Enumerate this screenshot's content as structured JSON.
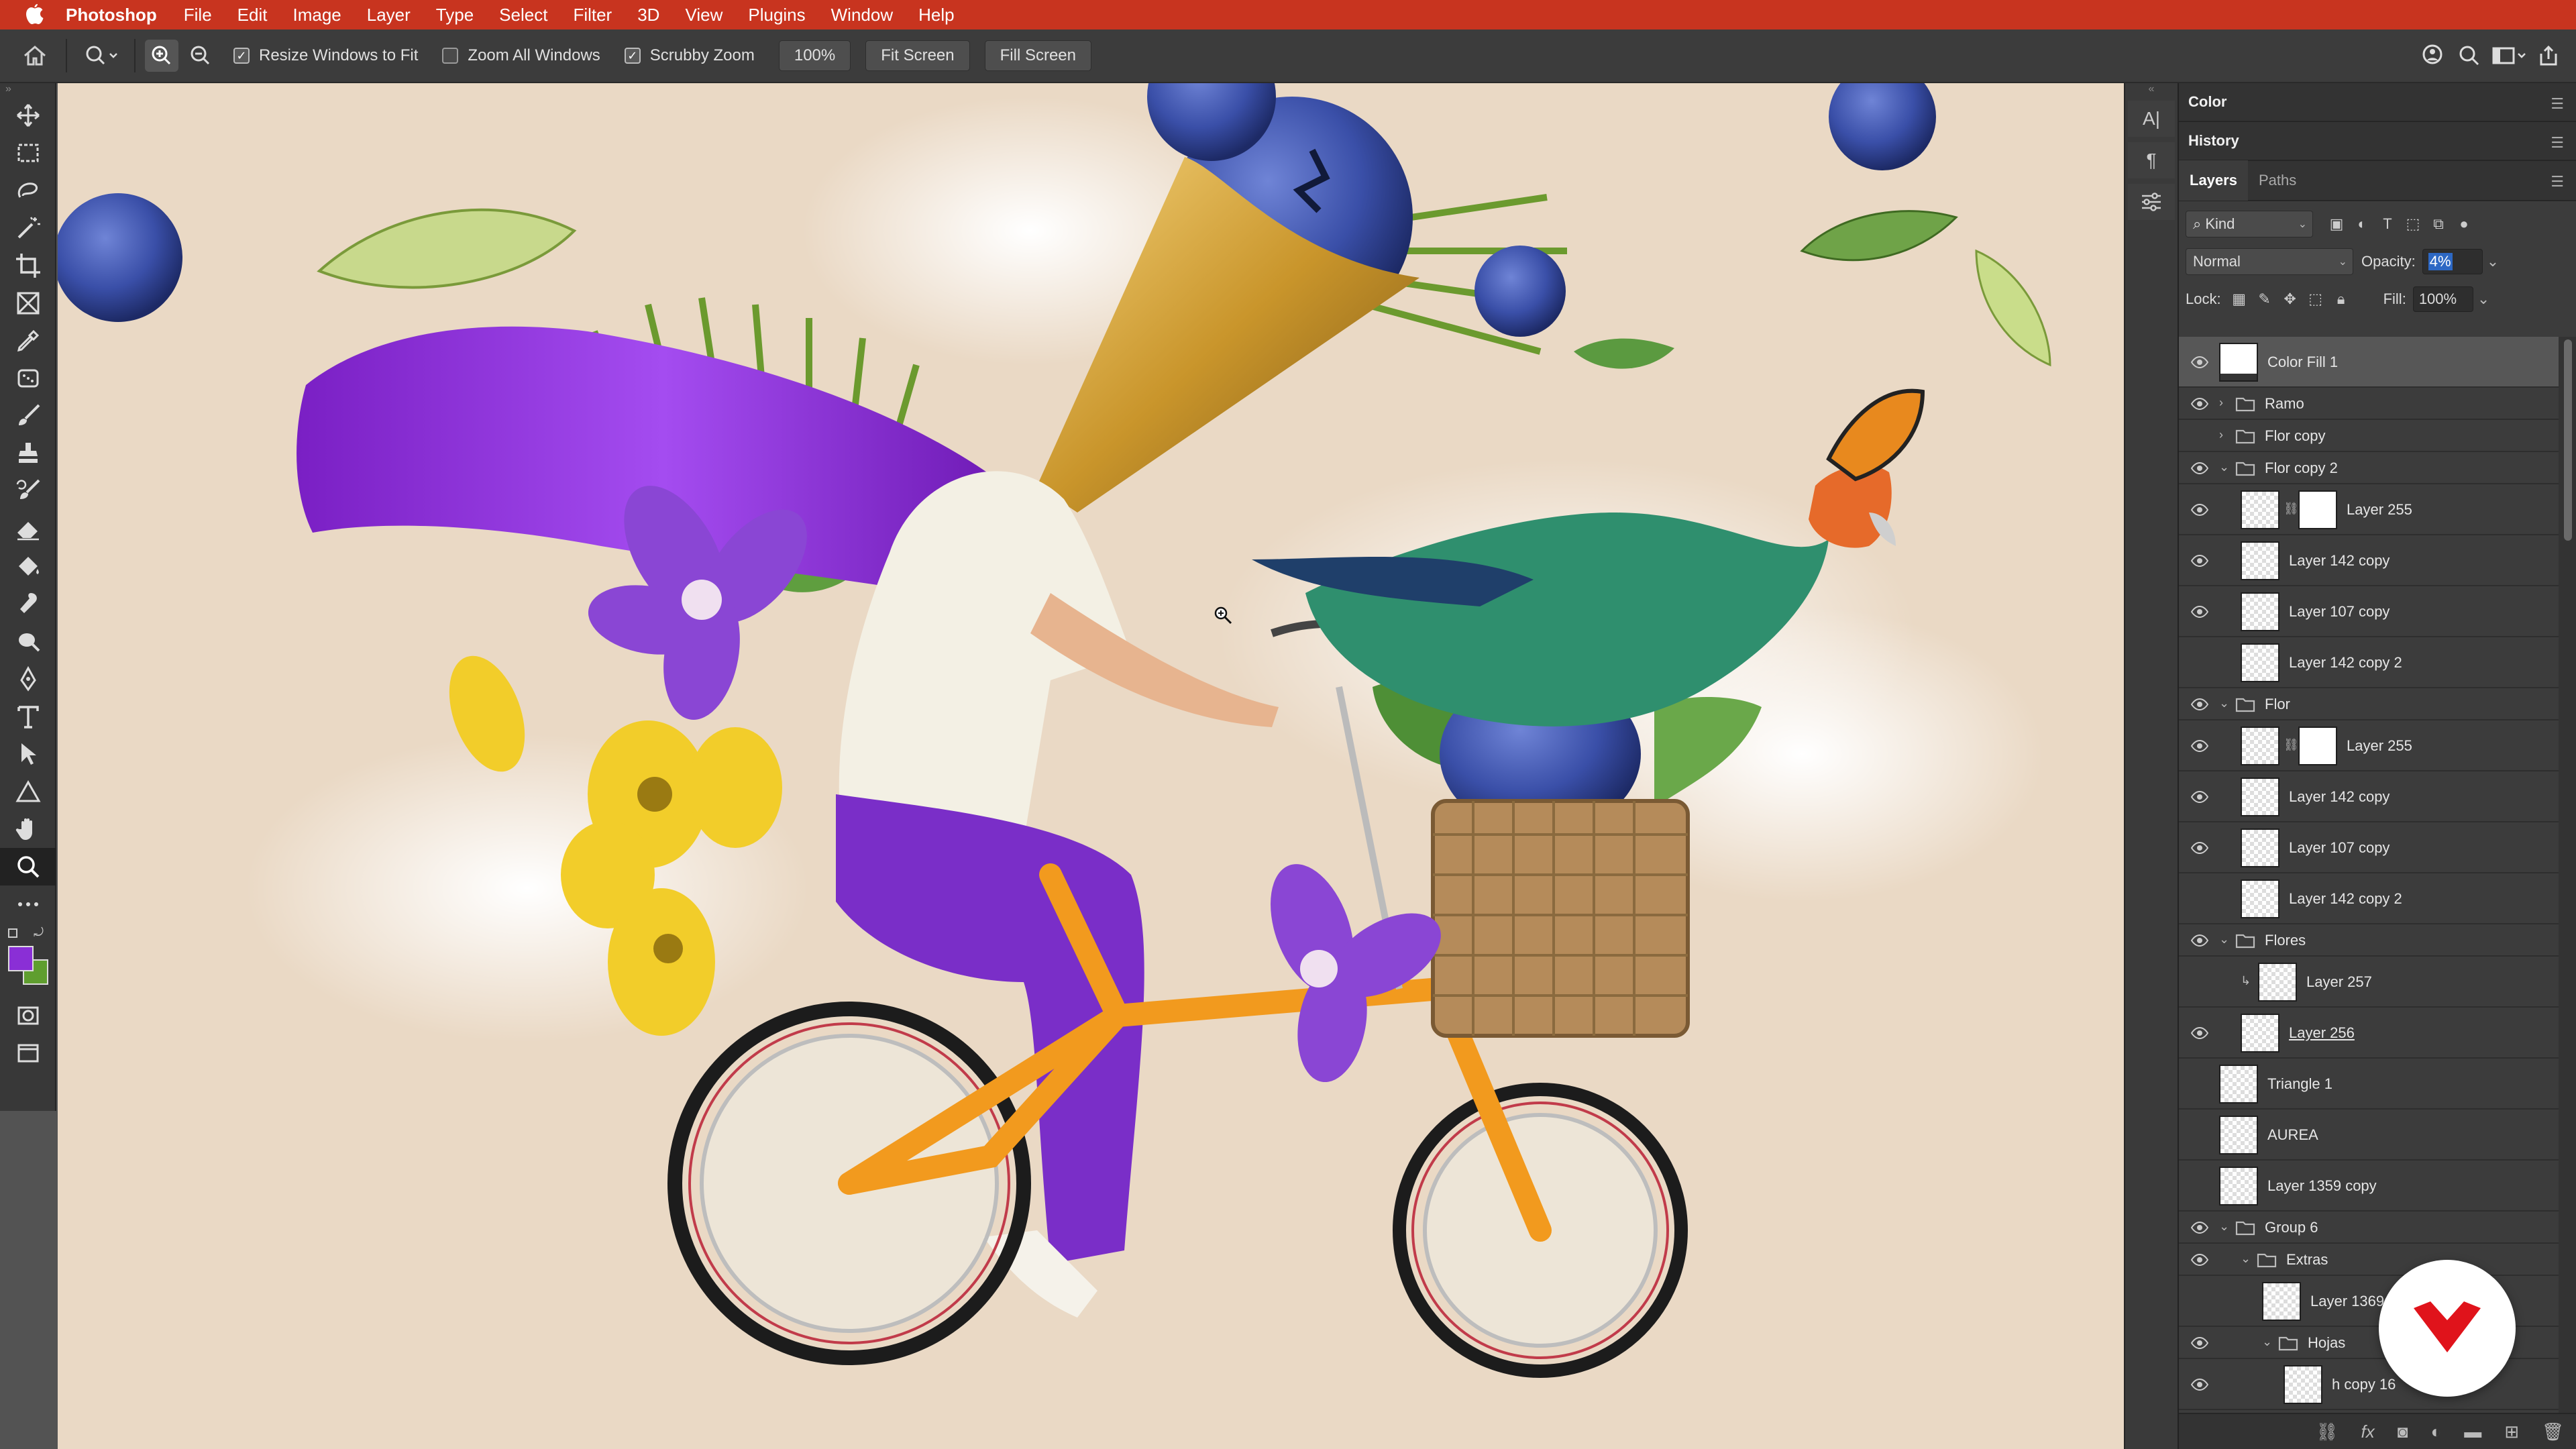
{
  "menubar": {
    "app_name": "Photoshop",
    "items": [
      "File",
      "Edit",
      "Image",
      "Layer",
      "Type",
      "Select",
      "Filter",
      "3D",
      "View",
      "Plugins",
      "Window",
      "Help"
    ],
    "bar_color": "#c8341f"
  },
  "options": {
    "resize_windows": {
      "label": "Resize Windows to Fit",
      "checked": true
    },
    "zoom_all": {
      "label": "Zoom All Windows",
      "checked": false
    },
    "scrubby": {
      "label": "Scrubby Zoom",
      "checked": true
    },
    "zoom_value": "100%",
    "fit_screen": "Fit Screen",
    "fill_screen": "Fill Screen"
  },
  "toolbar": {
    "tools": [
      "move-tool",
      "marquee-tool",
      "lasso-tool",
      "magic-wand-tool",
      "crop-tool",
      "frame-tool",
      "eyedropper-tool",
      "patch-tool",
      "brush-tool",
      "stamp-tool",
      "history-brush-tool",
      "eraser-tool",
      "paint-bucket-tool",
      "smudge-tool",
      "dodge-tool",
      "pen-tool",
      "type-tool",
      "path-select-tool",
      "shape-tool",
      "hand-tool",
      "zoom-tool",
      "more-tools"
    ],
    "active": "zoom-tool",
    "foreground_color": "#8a2fd6",
    "background_color": "#5f9e2f"
  },
  "strip": {
    "char_label": "A|",
    "para_label": "¶"
  },
  "panels": {
    "color_tab": "Color",
    "history_tab": "History",
    "layers_tab": "Layers",
    "paths_tab": "Paths",
    "kind_filter": "Kind",
    "blend_mode": "Normal",
    "opacity_label": "Opacity:",
    "opacity_value": "4%",
    "lock_label": "Lock:",
    "fill_label": "Fill:",
    "fill_value": "100%"
  },
  "layers": [
    {
      "name": "Color Fill 1",
      "type": "fill",
      "visible": true,
      "indent": 0,
      "selected": true
    },
    {
      "name": "Ramo",
      "type": "group",
      "visible": true,
      "indent": 0,
      "open": false
    },
    {
      "name": "Flor copy",
      "type": "group",
      "visible": false,
      "indent": 0,
      "open": false
    },
    {
      "name": "Flor copy 2",
      "type": "group",
      "visible": true,
      "indent": 0,
      "open": true
    },
    {
      "name": "Layer 255",
      "type": "masked",
      "visible": true,
      "indent": 1
    },
    {
      "name": "Layer 142 copy",
      "type": "layer",
      "visible": true,
      "indent": 1
    },
    {
      "name": "Layer 107 copy",
      "type": "layer",
      "visible": true,
      "indent": 1
    },
    {
      "name": "Layer 142 copy 2",
      "type": "layer",
      "visible": false,
      "indent": 1
    },
    {
      "name": "Flor",
      "type": "group",
      "visible": true,
      "indent": 0,
      "open": true
    },
    {
      "name": "Layer 255",
      "type": "masked",
      "visible": true,
      "indent": 1
    },
    {
      "name": "Layer 142 copy",
      "type": "layer",
      "visible": true,
      "indent": 1
    },
    {
      "name": "Layer 107 copy",
      "type": "layer",
      "visible": true,
      "indent": 1
    },
    {
      "name": "Layer 142 copy 2",
      "type": "layer",
      "visible": false,
      "indent": 1
    },
    {
      "name": "Flores",
      "type": "group",
      "visible": true,
      "indent": 0,
      "open": true
    },
    {
      "name": "Layer 257",
      "type": "clipped",
      "visible": false,
      "indent": 1
    },
    {
      "name": "Layer 256",
      "type": "layer",
      "visible": true,
      "indent": 1,
      "underline": true
    },
    {
      "name": "Triangle 1",
      "type": "shape",
      "visible": false,
      "indent": 0
    },
    {
      "name": "AUREA",
      "type": "shape",
      "visible": false,
      "indent": 0
    },
    {
      "name": "Layer 1359 copy",
      "type": "layer",
      "visible": false,
      "indent": 0
    },
    {
      "name": "Group 6",
      "type": "group",
      "visible": true,
      "indent": 0,
      "open": true
    },
    {
      "name": "Extras",
      "type": "group",
      "visible": true,
      "indent": 1,
      "open": true
    },
    {
      "name": "Layer 1369",
      "type": "layer",
      "visible": false,
      "indent": 2
    },
    {
      "name": "Hojas",
      "type": "group",
      "visible": true,
      "indent": 2,
      "open": true
    },
    {
      "name": "h copy 16",
      "type": "layer",
      "visible": true,
      "indent": 3
    }
  ],
  "footer_icons": [
    "link-icon",
    "fx-icon",
    "mask-icon",
    "adjustment-icon",
    "folder-icon",
    "new-layer-icon",
    "trash-icon"
  ]
}
